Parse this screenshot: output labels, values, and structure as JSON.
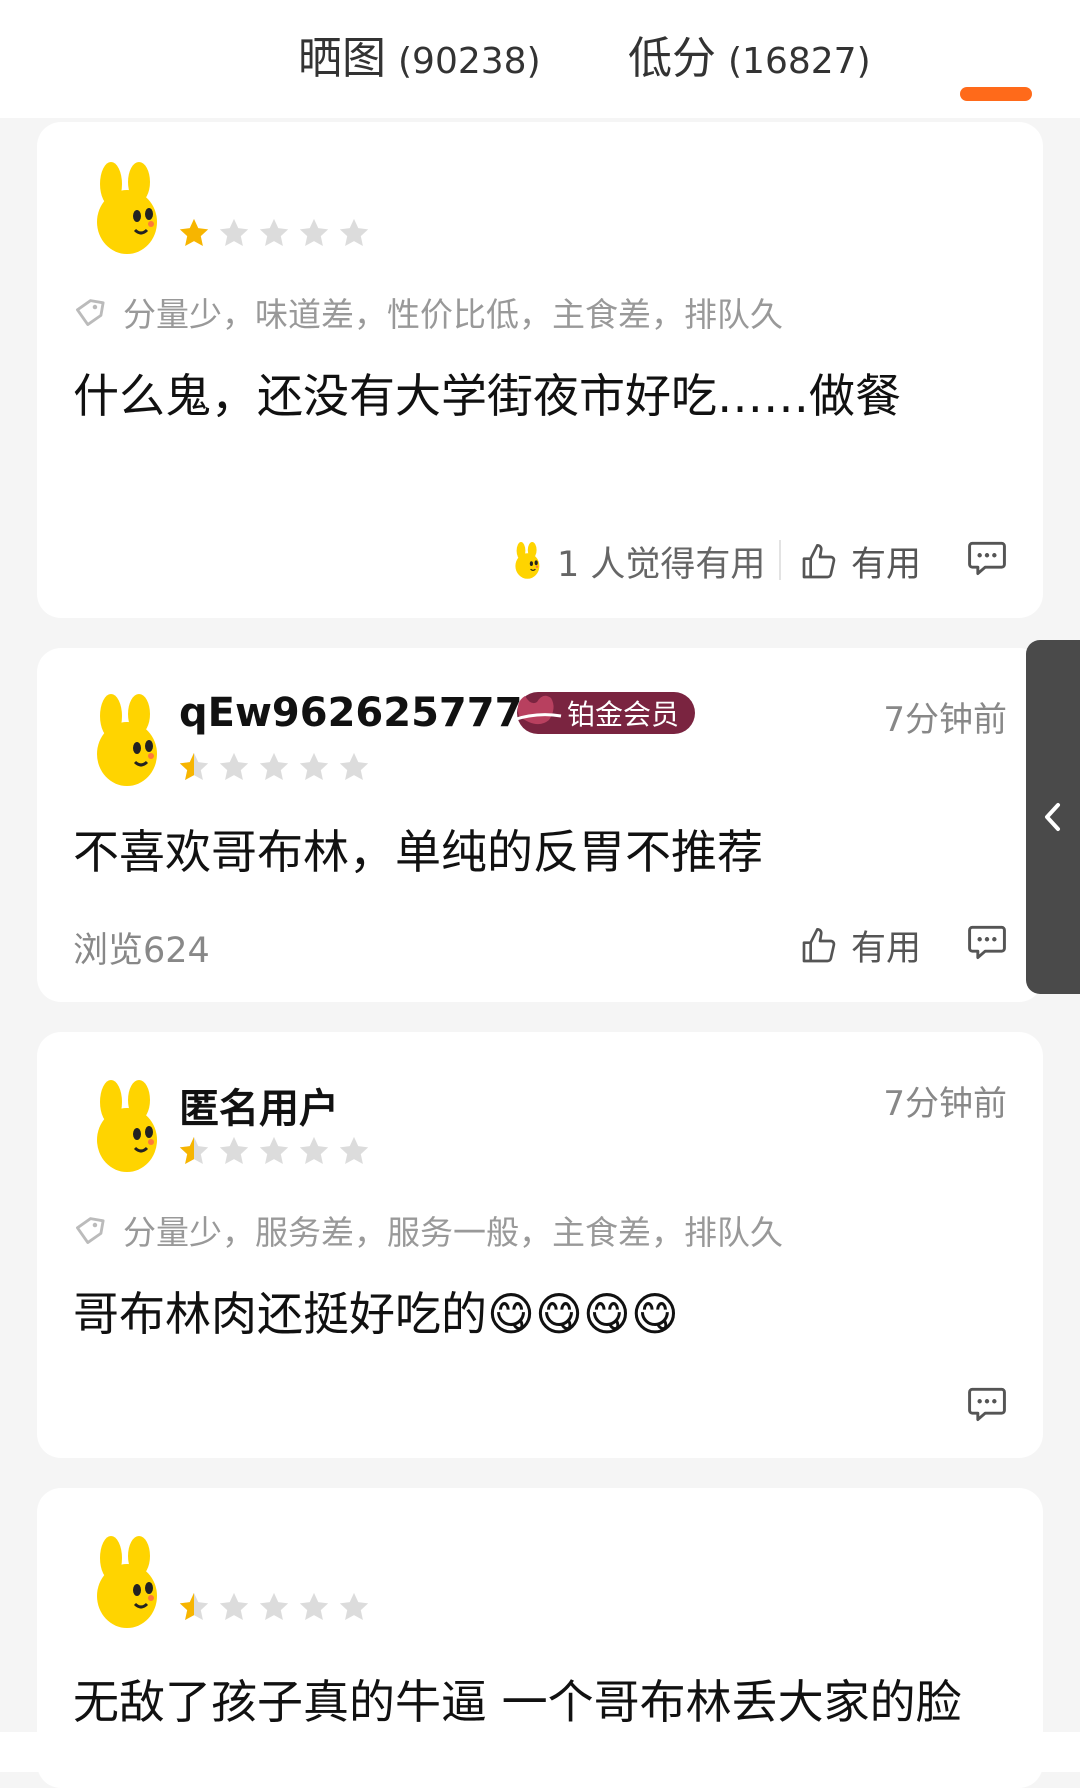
{
  "tabs": [
    {
      "label": "晒图",
      "count": "(90238)"
    },
    {
      "label": "低分",
      "count": "(16827)"
    }
  ],
  "colors": {
    "accent": "#ff6a1a",
    "star_filled": "#f7b500",
    "star_empty": "#dcdcdc",
    "vip_badge": "#7a2440",
    "avatar": "#ffd400"
  },
  "reviews": [
    {
      "username": "",
      "rating": 1,
      "tags": "分量少，味道差，性价比低，主食差，排队久",
      "content": "什么鬼，还没有大学街夜市好吃……做餐",
      "helpful_count": "1 人觉得有用",
      "useful_label": "有用"
    },
    {
      "username": "qEw962625777",
      "badge": "铂金会员",
      "timestamp": "7分钟前",
      "rating": 0.5,
      "content": "不喜欢哥布林，单纯的反胃不推荐",
      "views": "浏览624",
      "useful_label": "有用"
    },
    {
      "username": "匿名用户",
      "timestamp": "7分钟前",
      "rating": 0.5,
      "tags": "分量少，服务差，服务一般，主食差，排队久",
      "content": "哥布林肉还挺好吃的😋😋😋😋"
    },
    {
      "username": "",
      "rating": 0.5,
      "content": "无敌了孩子真的牛逼 一个哥布林丢大家的脸"
    }
  ]
}
